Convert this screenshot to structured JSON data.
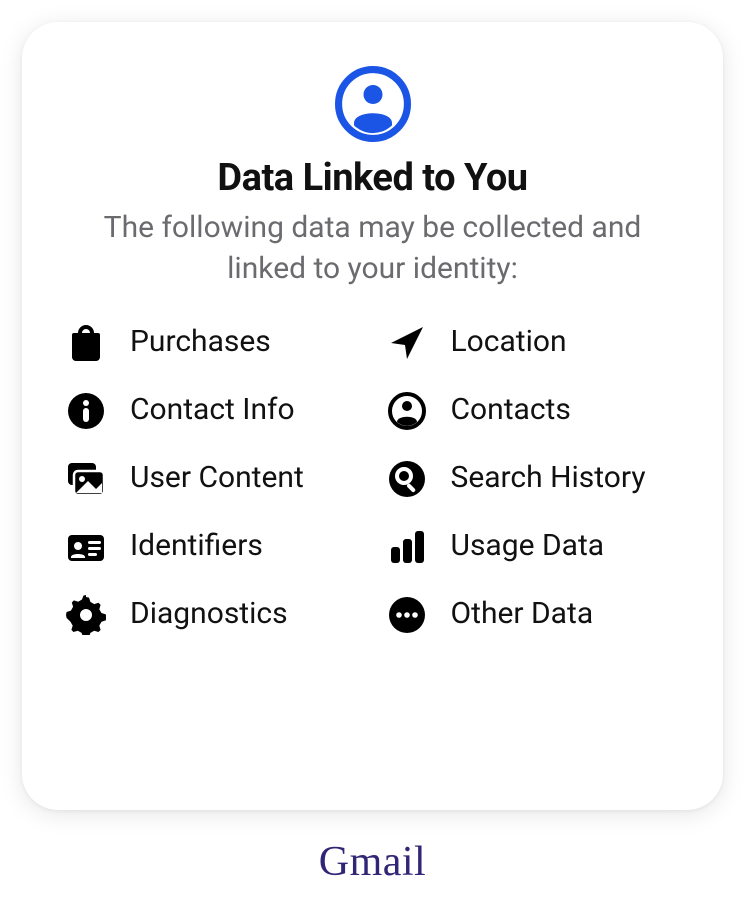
{
  "header": {
    "title": "Data Linked to You",
    "subtitle": "The following data may be collected and linked to your identity:"
  },
  "left_items": [
    {
      "label": "Purchases",
      "icon": "shopping-bag-icon"
    },
    {
      "label": "Contact Info",
      "icon": "info-icon"
    },
    {
      "label": "User Content",
      "icon": "media-icon"
    },
    {
      "label": "Identifiers",
      "icon": "id-card-icon"
    },
    {
      "label": "Diagnostics",
      "icon": "gear-icon"
    }
  ],
  "right_items": [
    {
      "label": "Location",
      "icon": "location-arrow-icon"
    },
    {
      "label": "Contacts",
      "icon": "person-circle-icon"
    },
    {
      "label": "Search History",
      "icon": "search-icon"
    },
    {
      "label": "Usage Data",
      "icon": "bar-chart-icon"
    },
    {
      "label": "Other Data",
      "icon": "ellipsis-circle-icon"
    }
  ],
  "app_name": "Gmail",
  "colors": {
    "hero_icon_blue": "#1b55e5",
    "subtitle_gray": "#6b6b6f",
    "app_name_purple": "#302675"
  }
}
